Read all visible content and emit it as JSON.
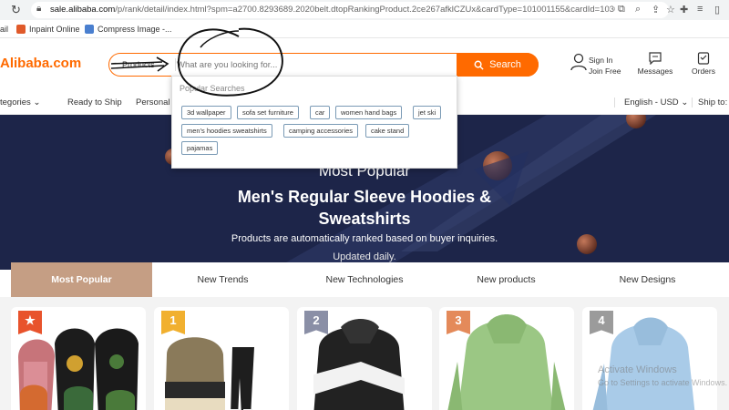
{
  "browser": {
    "url_domain": "sale.alibaba.com",
    "url_path": "/p/rank/detail/index.html?spm=a2700.8293689.2020belt.dtopRankingProduct.2ce267afklCZUx&cardType=101001155&cardId=1030000...",
    "bookmarks": [
      "ail",
      "Inpaint Online",
      "Compress Image -..."
    ]
  },
  "header": {
    "logo": "Alibaba.com",
    "search_category": "Products",
    "search_placeholder": "What are you looking for...",
    "search_button": "Search",
    "sign_in": "Sign In",
    "join_free": "Join Free",
    "messages": "Messages",
    "orders": "Orders"
  },
  "nav": {
    "categories": "tegories",
    "ready_to_ship": "Ready to Ship",
    "personal": "Personal",
    "language": "English - USD",
    "ship_to": "Ship to:"
  },
  "dropdown": {
    "title": "Popular Searches",
    "chips": [
      "3d wallpaper",
      "sofa set furniture",
      "car",
      "women hand bags",
      "jet ski",
      "men's hoodies sweatshirts",
      "camping accessories",
      "cake stand",
      "pajamas"
    ]
  },
  "banner": {
    "subtitle": "Most Popular",
    "title_line1": "Men's Regular Sleeve Hoodies &",
    "title_line2": "Sweatshirts",
    "description": "Products are automatically ranked based on buyer inquiries.",
    "updated": "Updated daily."
  },
  "tabs": [
    "Most Popular",
    "New Trends",
    "New Technologies",
    "New products",
    "New Designs"
  ],
  "products": {
    "ranks": [
      "★",
      "1",
      "2",
      "3",
      "4"
    ],
    "rank_colors": [
      "#e8532c",
      "#f1b02f",
      "#8a8fa6",
      "#e48a5a",
      "#9b9b9b"
    ]
  },
  "overlay": {
    "activate_line1": "Activate Windows",
    "activate_line2": "Go to Settings to activate Windows."
  },
  "colors": {
    "accent": "#ff6a00",
    "banner_bg": "#1d2549",
    "tab_active": "#c59e84"
  }
}
